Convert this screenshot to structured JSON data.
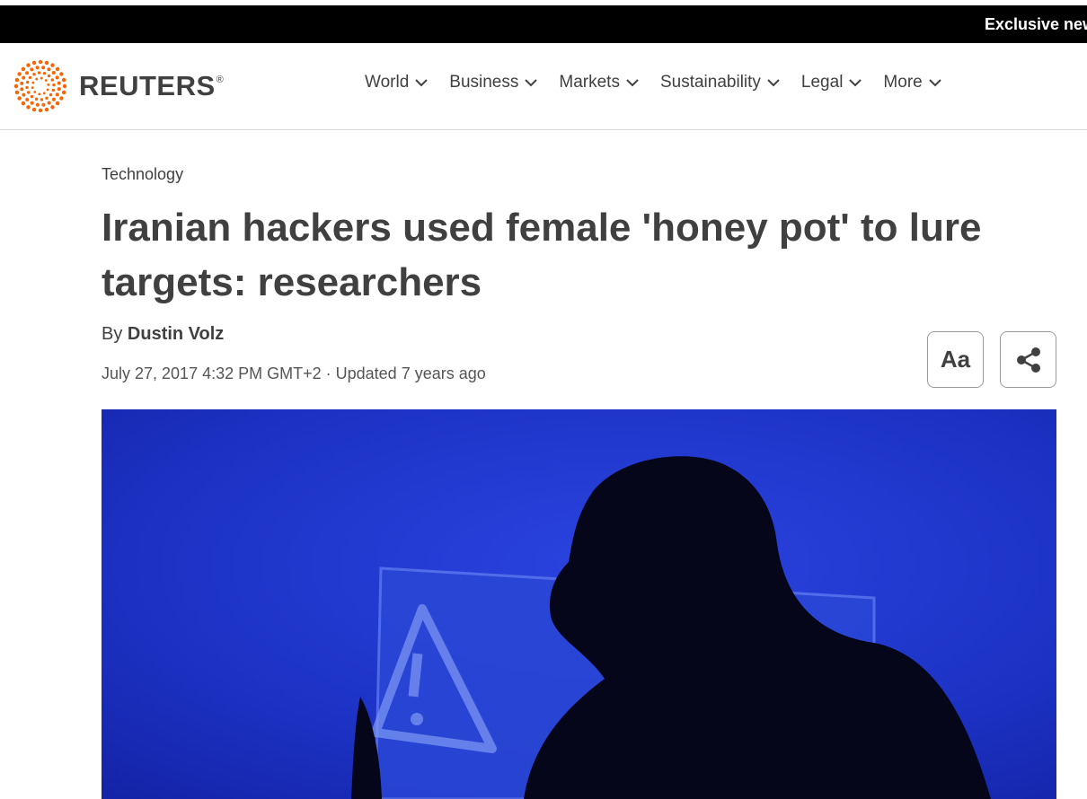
{
  "promo": {
    "text": "Exclusive news"
  },
  "brand": {
    "name": "REUTERS",
    "registered": "®",
    "accent": "#fa6400"
  },
  "nav": {
    "items": [
      {
        "label": "World"
      },
      {
        "label": "Business"
      },
      {
        "label": "Markets"
      },
      {
        "label": "Sustainability"
      },
      {
        "label": "Legal"
      },
      {
        "label": "More"
      }
    ]
  },
  "article": {
    "category": "Technology",
    "headline": "Iranian hackers used female 'honey pot' to lure targets: researchers",
    "byline_prefix": "By ",
    "author": "Dustin Volz",
    "date": "July 27, 2017 4:32 PM GMT+2",
    "updated": " · Updated 7 years ago"
  },
  "tools": {
    "text_size_label": "Aa",
    "share_icon": "share-icon"
  },
  "hero": {
    "description_colors": {
      "bg": "#1a2fc8",
      "silhouette": "#05061a"
    }
  }
}
